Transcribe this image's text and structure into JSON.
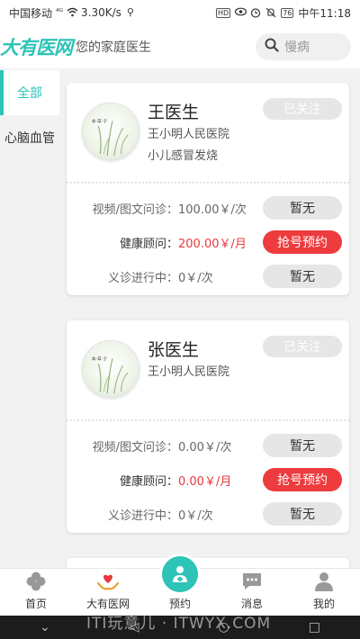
{
  "status_bar": {
    "carrier": "中国移动",
    "signal": "⁴ᴳ",
    "speed": "3.30K/s",
    "hd": "HD",
    "battery": "76",
    "time": "中午11:18"
  },
  "header": {
    "logo": "大有医网",
    "slogan": "您的家庭医生",
    "search_placeholder": "慢病"
  },
  "sidebar": {
    "items": [
      {
        "label": "全部",
        "active": true
      },
      {
        "label": "心脑血管",
        "active": false
      }
    ]
  },
  "doctors": [
    {
      "name": "王医生",
      "hospital": "王小明人民医院",
      "specialty": "小儿感冒发烧",
      "follow_label": "已关注",
      "services": [
        {
          "label": "视频/图文问诊：",
          "price": "100.00￥/次",
          "button": "暂无"
        },
        {
          "label": "健康顾问：",
          "price": "200.00￥/月",
          "button": "抢号预约"
        },
        {
          "label": "义诊进行中：",
          "price": "0￥/次",
          "button": "暂无"
        }
      ]
    },
    {
      "name": "张医生",
      "hospital": "王小明人民医院",
      "specialty": "",
      "follow_label": "已关注",
      "services": [
        {
          "label": "视频/图文问诊：",
          "price": "0.00￥/次",
          "button": "暂无"
        },
        {
          "label": "健康顾问：",
          "price": "0.00￥/月",
          "button": "抢号预约"
        },
        {
          "label": "义诊进行中：",
          "price": "0￥/次",
          "button": "暂无"
        }
      ]
    }
  ],
  "tabbar": {
    "tabs": [
      {
        "label": "首页",
        "icon": "clover-icon"
      },
      {
        "label": "大有医网",
        "icon": "heart-hands-icon"
      },
      {
        "label": "预约",
        "icon": "doctor-icon"
      },
      {
        "label": "消息",
        "icon": "chat-icon"
      },
      {
        "label": "我的",
        "icon": "user-icon"
      }
    ]
  },
  "watermark": "ITI玩意儿 · ITWYX.COM",
  "colors": {
    "brand": "#2dc3b7",
    "accent_red": "#ee3b3e",
    "disabled": "#e6e6e6"
  }
}
